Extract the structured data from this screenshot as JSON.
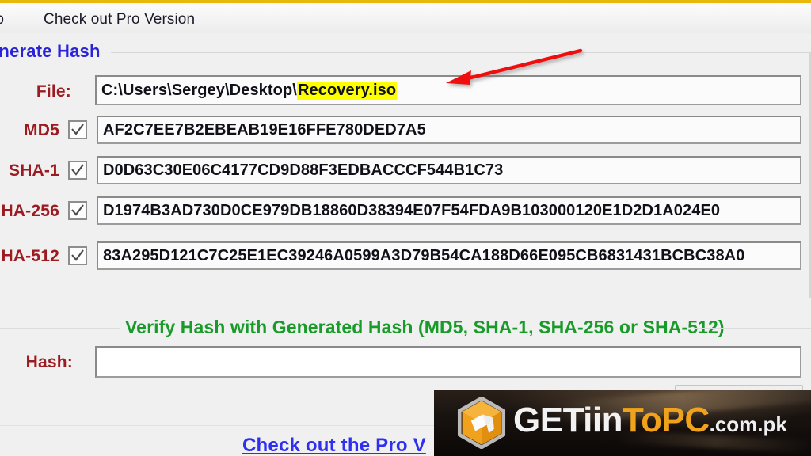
{
  "window": {
    "accent_top_color": "#e8b80c",
    "background_color": "#f0f0f0"
  },
  "menubar": {
    "items": [
      {
        "label": "lp",
        "name": "menu-help"
      },
      {
        "label": "Check out Pro Version",
        "name": "menu-check-out-pro-version"
      }
    ]
  },
  "generate_group": {
    "title": "enerate Hash",
    "title_color": "#2a24d8",
    "file": {
      "label": "File:",
      "path_prefix": "C:\\Users\\Sergey\\Desktop\\",
      "path_highlight": "Recovery.iso",
      "full_path": "C:\\Users\\Sergey\\Desktop\\Recovery.iso",
      "highlight_color": "#feff00"
    },
    "label_color": "#9d1a20",
    "rows": [
      {
        "label": "MD5",
        "checked": true,
        "value": "AF2C7EE7B2EBEAB19E16FFE780DED7A5"
      },
      {
        "label": "SHA-1",
        "checked": true,
        "value": "D0D63C30E06C4177CD9D88F3EDBACCCF544B1C73"
      },
      {
        "label": "HA-256",
        "checked": true,
        "value": "D1974B3AD730D0CE979DB18860D38394E07F54FDA9B103000120E1D2D1A024E0"
      },
      {
        "label": "HA-512",
        "checked": true,
        "value": "83A295D121C7C25E1EC39246A0599A3D79B54CA188D66E095CB6831431BCBC38A0"
      }
    ]
  },
  "verify_group": {
    "caption": "Verify Hash with Generated Hash (MD5, SHA-1, SHA-256 or SHA-512)",
    "caption_color": "#189b28",
    "hash_label": "Hash:",
    "hash_value": "",
    "hash_placeholder": ""
  },
  "footer": {
    "pro_link": "Check out the Pro V",
    "pro_link_color": "#2f2ff0"
  },
  "annotation": {
    "arrow_color": "#f01010",
    "arrow_points_to": "Recovery.iso"
  },
  "watermark": {
    "text_get": "GET",
    "text_iin": "iin",
    "text_to": "To",
    "text_pc": "PC",
    "text_tld": ".com.pk",
    "logo_icon": "box-hexagon-icon",
    "accent_color": "#f0a21c"
  }
}
